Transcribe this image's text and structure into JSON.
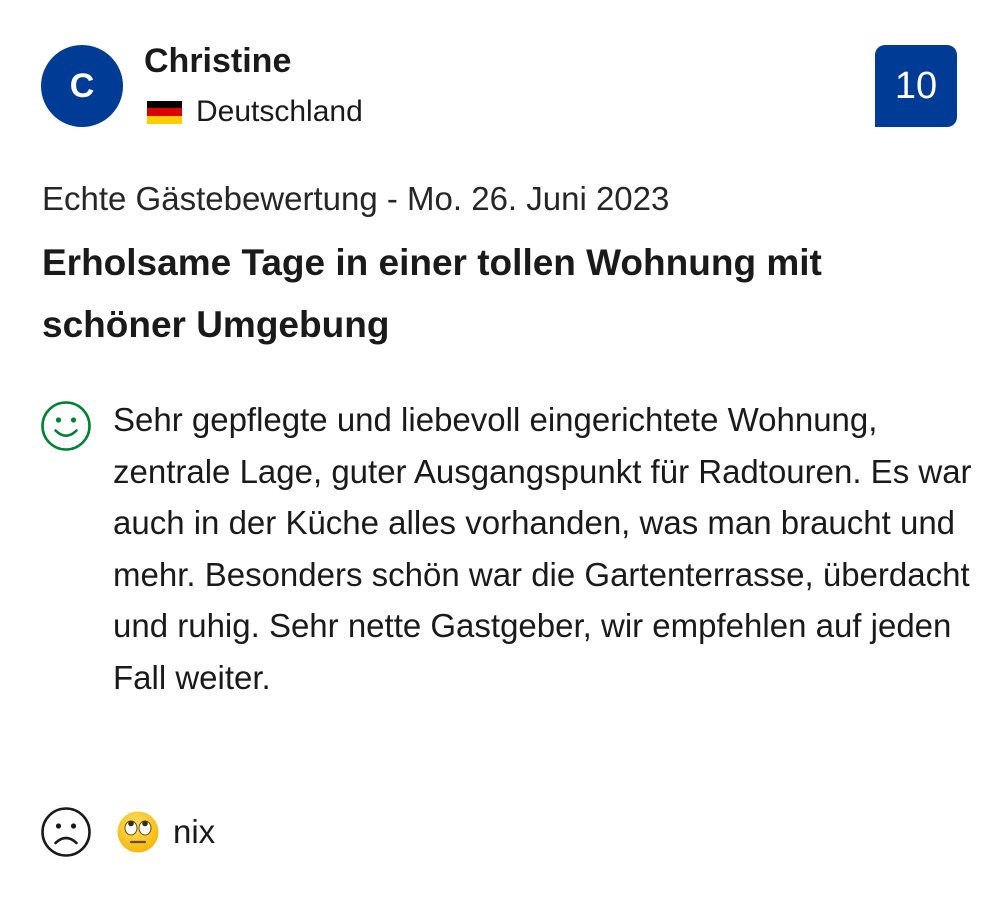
{
  "reviewer": {
    "initial": "C",
    "name": "Christine",
    "country": "Deutschland",
    "flag_icon": "germany-flag-icon"
  },
  "score": "10",
  "review": {
    "meta": "Echte Gästebewertung - Mo. 26. Juni 2023",
    "title": "Erholsame Tage in einer tollen Wohnung mit schöner Umgebung",
    "positive_icon": "smiley-happy-icon",
    "positive_text": "Sehr gepflegte und liebevoll eingerichtete Wohnung, zentrale Lage, guter Ausgangspunkt für Radtouren. Es war auch in der Küche alles vorhanden, was man braucht und mehr. Besonders schön war die Gartenterrasse, überdacht und ruhig. Sehr nette Gastgeber, wir empfehlen auf jeden Fall weiter.",
    "negative_icon": "smiley-sad-icon",
    "negative_emoji": "eye-roll-emoji-icon",
    "negative_text": "nix"
  },
  "colors": {
    "brand_blue": "#003b95",
    "positive_green": "#008234",
    "text": "#1a1a1a"
  }
}
